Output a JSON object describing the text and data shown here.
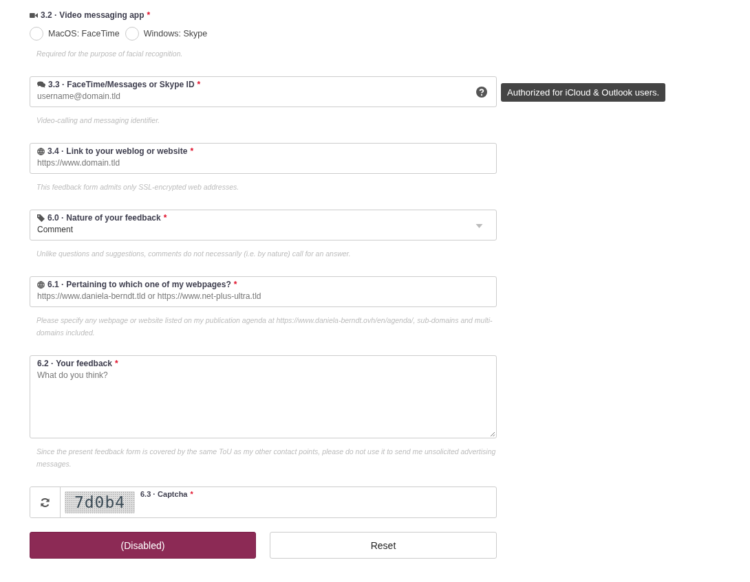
{
  "fields": [
    {
      "kind": "radio",
      "number": "3.2 · Video messaging app",
      "mark": "*",
      "options": [
        {
          "label": "MacOS: FaceTime",
          "selected": false
        },
        {
          "label": "Windows: Skype",
          "selected": false
        }
      ],
      "help": "Required for the purpose of facial recognition."
    },
    {
      "kind": "text",
      "number": "3.3 · FaceTime/Messages or Skype ID",
      "mark": "*",
      "placeholder": "username@domain.tld",
      "tooltip": "Authorized for iCloud & Outlook users.",
      "help": "Video-calling and messaging identifier."
    },
    {
      "kind": "text",
      "number": "3.4 · Link to your weblog or website",
      "mark": "*",
      "placeholder": "https://www.domain.tld",
      "help": "This feedback form admits only SSL-encrypted web addresses."
    },
    {
      "kind": "select",
      "number": "6.0 · Nature of your feedback",
      "mark": "*",
      "value": "Comment",
      "help": "Unlike questions and suggestions, comments do not necessarily (i.e. by nature) call for an answer."
    },
    {
      "kind": "text",
      "number": "6.1 · Pertaining to which one of my webpages?",
      "mark": "*",
      "placeholder": "https://www.daniela-berndt.tld or https://www.net-plus-ultra.tld",
      "help": "Please specify any webpage or website listed on my publication agenda at https://www.daniela-berndt.ovh/en/agenda/, sub-domains and multi-domains included."
    },
    {
      "kind": "textarea",
      "number": "6.2 · Your feedback",
      "mark": "*",
      "placeholder": "What do you think?",
      "help": "Since the present feedback form is covered by the same ToU as my other contact points, please do not use it to send me unsolicited advertising messages."
    },
    {
      "kind": "captcha",
      "number": "6.3 · Captcha",
      "mark": "*",
      "captcha_text": "7d0b4"
    }
  ],
  "buttons": [
    {
      "label": "(Disabled)",
      "kind": "primary"
    },
    {
      "label": "Reset",
      "kind": "secondary"
    }
  ]
}
